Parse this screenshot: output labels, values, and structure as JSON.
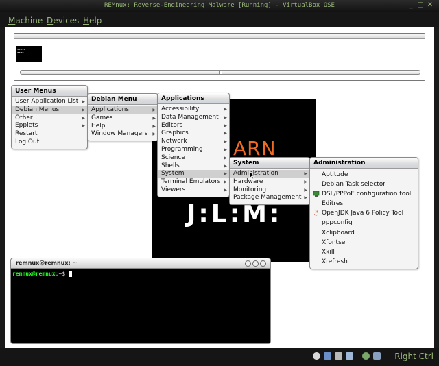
{
  "window": {
    "title": "REMnux: Reverse-Engineering Malware [Running] - VirtualBox OSE",
    "controls": [
      "_",
      "□",
      "✕"
    ]
  },
  "menubar": {
    "machine": "achine",
    "machine_mn": "M",
    "devices": "evices",
    "devices_mn": "D",
    "help": "elp",
    "help_mn": "H"
  },
  "user_menus": {
    "title": "User Menus",
    "items": [
      {
        "label": "User Application List",
        "submenu": true
      },
      {
        "label": "Debian Menus",
        "submenu": true,
        "selected": true
      },
      {
        "label": "Other",
        "submenu": true
      },
      {
        "label": "Epplets",
        "submenu": true
      },
      {
        "label": "Restart",
        "submenu": false
      },
      {
        "label": "Log Out",
        "submenu": false
      }
    ]
  },
  "debian_menu": {
    "title": "Debian Menu",
    "items": [
      {
        "label": "Applications",
        "submenu": true,
        "selected": true
      },
      {
        "label": "Games",
        "submenu": true
      },
      {
        "label": "Help",
        "submenu": true
      },
      {
        "label": "Window Managers",
        "submenu": true
      }
    ]
  },
  "applications": {
    "title": "Applications",
    "items": [
      {
        "label": "Accessibility",
        "submenu": true
      },
      {
        "label": "Data Management",
        "submenu": true
      },
      {
        "label": "Editors",
        "submenu": true
      },
      {
        "label": "Graphics",
        "submenu": true
      },
      {
        "label": "Network",
        "submenu": true
      },
      {
        "label": "Programming",
        "submenu": true
      },
      {
        "label": "Science",
        "submenu": true
      },
      {
        "label": "Shells",
        "submenu": true
      },
      {
        "label": "System",
        "submenu": true,
        "selected": true
      },
      {
        "label": "Terminal Emulators",
        "submenu": true
      },
      {
        "label": "Viewers",
        "submenu": true
      }
    ]
  },
  "system": {
    "title": "System",
    "items": [
      {
        "label": "Administration",
        "submenu": true,
        "selected": true
      },
      {
        "label": "Hardware",
        "submenu": true
      },
      {
        "label": "Monitoring",
        "submenu": true
      },
      {
        "label": "Package Management",
        "submenu": true
      }
    ]
  },
  "administration": {
    "title": "Administration",
    "items": [
      {
        "label": "Aptitude",
        "icon": ""
      },
      {
        "label": "Debian Task selector",
        "icon": ""
      },
      {
        "label": "DSL/PPPoE configuration tool",
        "icon": "network-icon"
      },
      {
        "label": "Editres",
        "icon": ""
      },
      {
        "label": "OpenJDK Java 6 Policy Tool",
        "icon": "java-icon"
      },
      {
        "label": "pppconfig",
        "icon": ""
      },
      {
        "label": "Xclipboard",
        "icon": ""
      },
      {
        "label": "Xfontsel",
        "icon": ""
      },
      {
        "label": "Xkill",
        "icon": ""
      },
      {
        "label": "Xrefresh",
        "icon": ""
      }
    ]
  },
  "splash": {
    "text": "ARN",
    "logo": "J:L:M:"
  },
  "terminal": {
    "title": "remnux@remnux: ~",
    "prompt_user": "remnux@remnux",
    "prompt_rest": ":~$ "
  },
  "statusbar": {
    "host_key": "Right Ctrl",
    "icons": [
      "hdd-icon",
      "network-icon",
      "usb-icon",
      "shared-folder-icon",
      "display-icon",
      "mouse-integration-icon"
    ]
  },
  "colors": {
    "vbox_text": "#9ab87a",
    "splash_orange": "#f26a22",
    "prompt_green": "#22ff22"
  }
}
